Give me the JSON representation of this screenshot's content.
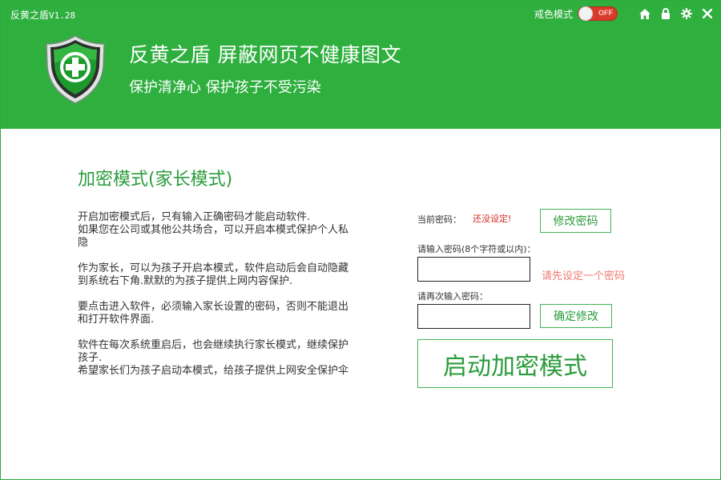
{
  "app": {
    "name": "反黄之盾",
    "version": "V1.28"
  },
  "header": {
    "abstain_label": "戒色模式",
    "toggle_state": "OFF",
    "headline": "反黄之盾 屏蔽网页不健康图文",
    "subline": "保护清净心 保护孩子不受污染",
    "icons": [
      "home-icon",
      "lock-icon",
      "gear-icon",
      "close-icon"
    ]
  },
  "main": {
    "section_title": "加密模式(家长模式)",
    "paragraphs": [
      "开启加密模式后，只有输入正确密码才能启动软件.\n如果您在公司或其他公共场合，可以开启本模式保护个人私隐",
      "作为家长，可以为孩子开启本模式，软件启动后会自动隐藏到系统右下角.默默的为孩子提供上网内容保护.",
      "要点击进入软件，必须输入家长设置的密码，否则不能退出和打开软件界面.",
      "软件在每次系统重启后，也会继续执行家长模式，继续保护孩子.\n希望家长们为孩子启动本模式，给孩子提供上网安全保护伞"
    ]
  },
  "password": {
    "current_label": "当前密码：",
    "current_value": "还没设定!",
    "change_button": "修改密码",
    "enter_label": "请输入密码(8个字符或以内)：",
    "enter_value": "",
    "hint": "请先设定一个密码",
    "repeat_label": "请再次输入密码：",
    "repeat_value": "",
    "confirm_button": "确定修改",
    "start_button": "启动加密模式"
  },
  "colors": {
    "brand_green": "#2eaf3e",
    "text_green": "#2a9c3b",
    "warning_red": "#d42a1f",
    "hint_red": "#f07a72",
    "toggle_red": "#d93a2b"
  }
}
